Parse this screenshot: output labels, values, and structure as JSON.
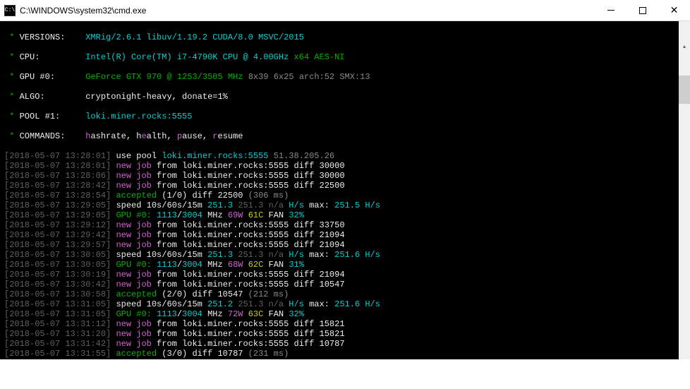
{
  "titlebar": {
    "title": "C:\\WINDOWS\\system32\\cmd.exe",
    "icon_text": "C:\\"
  },
  "header": {
    "versions": {
      "k": "VERSIONS:",
      "v": "XMRig/2.6.1 libuv/1.19.2 CUDA/8.0 MSVC/2015"
    },
    "cpu": {
      "k": "CPU:",
      "intel": "Intel(R) Core(TM) i7-4790K CPU @ 4.00GHz",
      "x64": "x64",
      "aes": "AES-NI"
    },
    "gpu": {
      "k": "GPU #0:",
      "model": "GeForce GTX 970 @ 1253/3505 MHz",
      "detail": "8x39 6x25 arch:52 SMX:13"
    },
    "algo": {
      "k": "ALGO:",
      "v": "cryptonight-heavy, donate=1%"
    },
    "pool": {
      "k": "POOL #1:",
      "v": "loki.miner.rocks:5555"
    },
    "commands": {
      "k": "COMMANDS:",
      "h": "h",
      "ashrate": "ashrate, ",
      "e": "e",
      "alth": "alth, ",
      "p": "p",
      "ause": "ause, ",
      "r": "r",
      "esume": "esume"
    }
  },
  "logs": [
    {
      "ts": "[2018-05-07 13:28:01]",
      "type": "pool",
      "pre": "use pool ",
      "pool": "loki.miner.rocks:5555",
      "ip": "51.38.205.26"
    },
    {
      "ts": "[2018-05-07 13:28:01]",
      "type": "job",
      "diff": "30000"
    },
    {
      "ts": "[2018-05-07 13:28:06]",
      "type": "job",
      "diff": "30000"
    },
    {
      "ts": "[2018-05-07 13:28:42]",
      "type": "job",
      "diff": "22500"
    },
    {
      "ts": "[2018-05-07 13:28:54]",
      "type": "acc",
      "ratio": "(1/0)",
      "diff": "22500",
      "ms": "(306 ms)"
    },
    {
      "ts": "[2018-05-07 13:29:05]",
      "type": "spd",
      "s1": "251.3",
      "s2": "251.3 n/a",
      "max": "251.5 H/s"
    },
    {
      "ts": "[2018-05-07 13:29:05]",
      "type": "gpu",
      "clk": "1113",
      "mem": "3004",
      "w": "69W",
      "tmp": "61C",
      "fan": "32%"
    },
    {
      "ts": "[2018-05-07 13:29:12]",
      "type": "job",
      "diff": "33750"
    },
    {
      "ts": "[2018-05-07 13:29:42]",
      "type": "job",
      "diff": "21094"
    },
    {
      "ts": "[2018-05-07 13:29:57]",
      "type": "job",
      "diff": "21094"
    },
    {
      "ts": "[2018-05-07 13:30:05]",
      "type": "spd",
      "s1": "251.3",
      "s2": "251.3 n/a",
      "max": "251.6 H/s"
    },
    {
      "ts": "[2018-05-07 13:30:05]",
      "type": "gpu",
      "clk": "1113",
      "mem": "3004",
      "w": "68W",
      "tmp": "62C",
      "fan": "31%"
    },
    {
      "ts": "[2018-05-07 13:30:19]",
      "type": "job",
      "diff": "21094"
    },
    {
      "ts": "[2018-05-07 13:30:42]",
      "type": "job",
      "diff": "10547"
    },
    {
      "ts": "[2018-05-07 13:30:58]",
      "type": "acc",
      "ratio": "(2/0)",
      "diff": "10547",
      "ms": "(212 ms)"
    },
    {
      "ts": "[2018-05-07 13:31:05]",
      "type": "spd",
      "s1": "251.2",
      "s2": "251.3 n/a",
      "max": "251.6 H/s"
    },
    {
      "ts": "[2018-05-07 13:31:05]",
      "type": "gpu",
      "clk": "1113",
      "mem": "3004",
      "w": "72W",
      "tmp": "63C",
      "fan": "32%"
    },
    {
      "ts": "[2018-05-07 13:31:12]",
      "type": "job",
      "diff": "15821"
    },
    {
      "ts": "[2018-05-07 13:31:20]",
      "type": "job",
      "diff": "15821"
    },
    {
      "ts": "[2018-05-07 13:31:42]",
      "type": "job",
      "diff": "10787"
    },
    {
      "ts": "[2018-05-07 13:31:55]",
      "type": "acc",
      "ratio": "(3/0)",
      "diff": "10787",
      "ms": "(231 ms)"
    }
  ],
  "strings": {
    "job_new": "new job",
    "job_from": " from ",
    "job_pool": "loki.miner.rocks:5555",
    "job_diff": " diff ",
    "acc": "accepted",
    "acc_diff": " diff ",
    "spd": "speed 10s/60s/15m ",
    "h_s": "H/s ",
    " max": "max:",
    "gpu_lbl": "GPU #0:",
    "mhz": "MHz",
    "fan": "FAN "
  }
}
